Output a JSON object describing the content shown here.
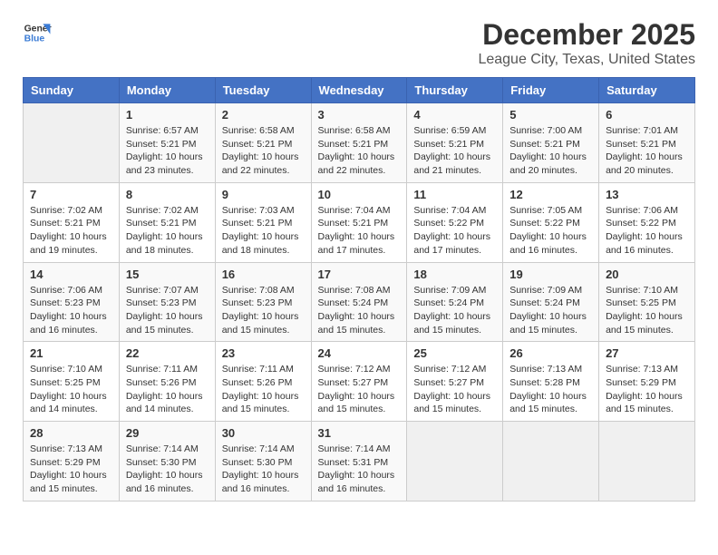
{
  "logo": {
    "line1": "General",
    "line2": "Blue"
  },
  "header": {
    "month": "December 2025",
    "location": "League City, Texas, United States"
  },
  "weekdays": [
    "Sunday",
    "Monday",
    "Tuesday",
    "Wednesday",
    "Thursday",
    "Friday",
    "Saturday"
  ],
  "weeks": [
    [
      {
        "day": "",
        "info": ""
      },
      {
        "day": "1",
        "info": "Sunrise: 6:57 AM\nSunset: 5:21 PM\nDaylight: 10 hours\nand 23 minutes."
      },
      {
        "day": "2",
        "info": "Sunrise: 6:58 AM\nSunset: 5:21 PM\nDaylight: 10 hours\nand 22 minutes."
      },
      {
        "day": "3",
        "info": "Sunrise: 6:58 AM\nSunset: 5:21 PM\nDaylight: 10 hours\nand 22 minutes."
      },
      {
        "day": "4",
        "info": "Sunrise: 6:59 AM\nSunset: 5:21 PM\nDaylight: 10 hours\nand 21 minutes."
      },
      {
        "day": "5",
        "info": "Sunrise: 7:00 AM\nSunset: 5:21 PM\nDaylight: 10 hours\nand 20 minutes."
      },
      {
        "day": "6",
        "info": "Sunrise: 7:01 AM\nSunset: 5:21 PM\nDaylight: 10 hours\nand 20 minutes."
      }
    ],
    [
      {
        "day": "7",
        "info": "Sunrise: 7:02 AM\nSunset: 5:21 PM\nDaylight: 10 hours\nand 19 minutes."
      },
      {
        "day": "8",
        "info": "Sunrise: 7:02 AM\nSunset: 5:21 PM\nDaylight: 10 hours\nand 18 minutes."
      },
      {
        "day": "9",
        "info": "Sunrise: 7:03 AM\nSunset: 5:21 PM\nDaylight: 10 hours\nand 18 minutes."
      },
      {
        "day": "10",
        "info": "Sunrise: 7:04 AM\nSunset: 5:21 PM\nDaylight: 10 hours\nand 17 minutes."
      },
      {
        "day": "11",
        "info": "Sunrise: 7:04 AM\nSunset: 5:22 PM\nDaylight: 10 hours\nand 17 minutes."
      },
      {
        "day": "12",
        "info": "Sunrise: 7:05 AM\nSunset: 5:22 PM\nDaylight: 10 hours\nand 16 minutes."
      },
      {
        "day": "13",
        "info": "Sunrise: 7:06 AM\nSunset: 5:22 PM\nDaylight: 10 hours\nand 16 minutes."
      }
    ],
    [
      {
        "day": "14",
        "info": "Sunrise: 7:06 AM\nSunset: 5:23 PM\nDaylight: 10 hours\nand 16 minutes."
      },
      {
        "day": "15",
        "info": "Sunrise: 7:07 AM\nSunset: 5:23 PM\nDaylight: 10 hours\nand 15 minutes."
      },
      {
        "day": "16",
        "info": "Sunrise: 7:08 AM\nSunset: 5:23 PM\nDaylight: 10 hours\nand 15 minutes."
      },
      {
        "day": "17",
        "info": "Sunrise: 7:08 AM\nSunset: 5:24 PM\nDaylight: 10 hours\nand 15 minutes."
      },
      {
        "day": "18",
        "info": "Sunrise: 7:09 AM\nSunset: 5:24 PM\nDaylight: 10 hours\nand 15 minutes."
      },
      {
        "day": "19",
        "info": "Sunrise: 7:09 AM\nSunset: 5:24 PM\nDaylight: 10 hours\nand 15 minutes."
      },
      {
        "day": "20",
        "info": "Sunrise: 7:10 AM\nSunset: 5:25 PM\nDaylight: 10 hours\nand 15 minutes."
      }
    ],
    [
      {
        "day": "21",
        "info": "Sunrise: 7:10 AM\nSunset: 5:25 PM\nDaylight: 10 hours\nand 14 minutes."
      },
      {
        "day": "22",
        "info": "Sunrise: 7:11 AM\nSunset: 5:26 PM\nDaylight: 10 hours\nand 14 minutes."
      },
      {
        "day": "23",
        "info": "Sunrise: 7:11 AM\nSunset: 5:26 PM\nDaylight: 10 hours\nand 15 minutes."
      },
      {
        "day": "24",
        "info": "Sunrise: 7:12 AM\nSunset: 5:27 PM\nDaylight: 10 hours\nand 15 minutes."
      },
      {
        "day": "25",
        "info": "Sunrise: 7:12 AM\nSunset: 5:27 PM\nDaylight: 10 hours\nand 15 minutes."
      },
      {
        "day": "26",
        "info": "Sunrise: 7:13 AM\nSunset: 5:28 PM\nDaylight: 10 hours\nand 15 minutes."
      },
      {
        "day": "27",
        "info": "Sunrise: 7:13 AM\nSunset: 5:29 PM\nDaylight: 10 hours\nand 15 minutes."
      }
    ],
    [
      {
        "day": "28",
        "info": "Sunrise: 7:13 AM\nSunset: 5:29 PM\nDaylight: 10 hours\nand 15 minutes."
      },
      {
        "day": "29",
        "info": "Sunrise: 7:14 AM\nSunset: 5:30 PM\nDaylight: 10 hours\nand 16 minutes."
      },
      {
        "day": "30",
        "info": "Sunrise: 7:14 AM\nSunset: 5:30 PM\nDaylight: 10 hours\nand 16 minutes."
      },
      {
        "day": "31",
        "info": "Sunrise: 7:14 AM\nSunset: 5:31 PM\nDaylight: 10 hours\nand 16 minutes."
      },
      {
        "day": "",
        "info": ""
      },
      {
        "day": "",
        "info": ""
      },
      {
        "day": "",
        "info": ""
      }
    ]
  ]
}
